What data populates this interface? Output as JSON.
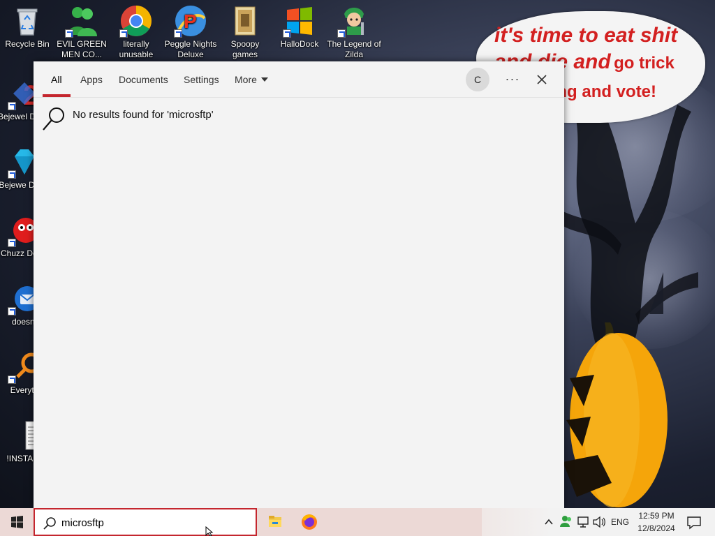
{
  "desktop": {
    "top_row": [
      {
        "label": "Recycle Bin",
        "icon": "recycle-bin-icon"
      },
      {
        "label": "EVIL GREEN MEN CO...",
        "icon": "green-people-icon"
      },
      {
        "label": "literally unusable",
        "icon": "chrome-icon"
      },
      {
        "label": "Peggle Nights Deluxe",
        "icon": "peggle-icon"
      },
      {
        "label": "Spoopy games",
        "icon": "folder-icon"
      },
      {
        "label": "HalloDock",
        "icon": "windows-logo-icon"
      },
      {
        "label": "The Legend of Zilda",
        "icon": "zilda-icon"
      }
    ],
    "left_column": [
      {
        "label": "Bejewel Delux",
        "icon": "bejeweled-2-icon"
      },
      {
        "label": "Bejewe Delux",
        "icon": "diamond-icon"
      },
      {
        "label": "Chuzz Delux",
        "icon": "chuzzle-icon"
      },
      {
        "label": "doesnt",
        "icon": "thunderbird-icon"
      },
      {
        "label": "Everyth",
        "icon": "everything-icon"
      },
      {
        "label": "!INSTALL",
        "icon": "text-file-icon"
      }
    ]
  },
  "wallpaper": {
    "bubble_line1": "it's time to eat shit",
    "bubble_line2a": "and die and",
    "bubble_line2b": "go trick",
    "bubble_line3": "or treating and vote!"
  },
  "search_window": {
    "tabs": [
      {
        "label": "All",
        "active": true
      },
      {
        "label": "Apps",
        "active": false
      },
      {
        "label": "Documents",
        "active": false
      },
      {
        "label": "Settings",
        "active": false
      },
      {
        "label": "More",
        "active": false
      }
    ],
    "avatar_letter": "C",
    "more_options": "···",
    "no_results_message": "No results found for 'microsftp'"
  },
  "taskbar": {
    "search_value": "microsftp",
    "language": "ENG",
    "time": "12:59 PM",
    "date": "12/8/2024"
  },
  "colors": {
    "accent": "#c4262e",
    "window_bg": "#f3f3f3",
    "taskbar_bg": "#ecd9d6",
    "bubble_text": "#d32020"
  }
}
